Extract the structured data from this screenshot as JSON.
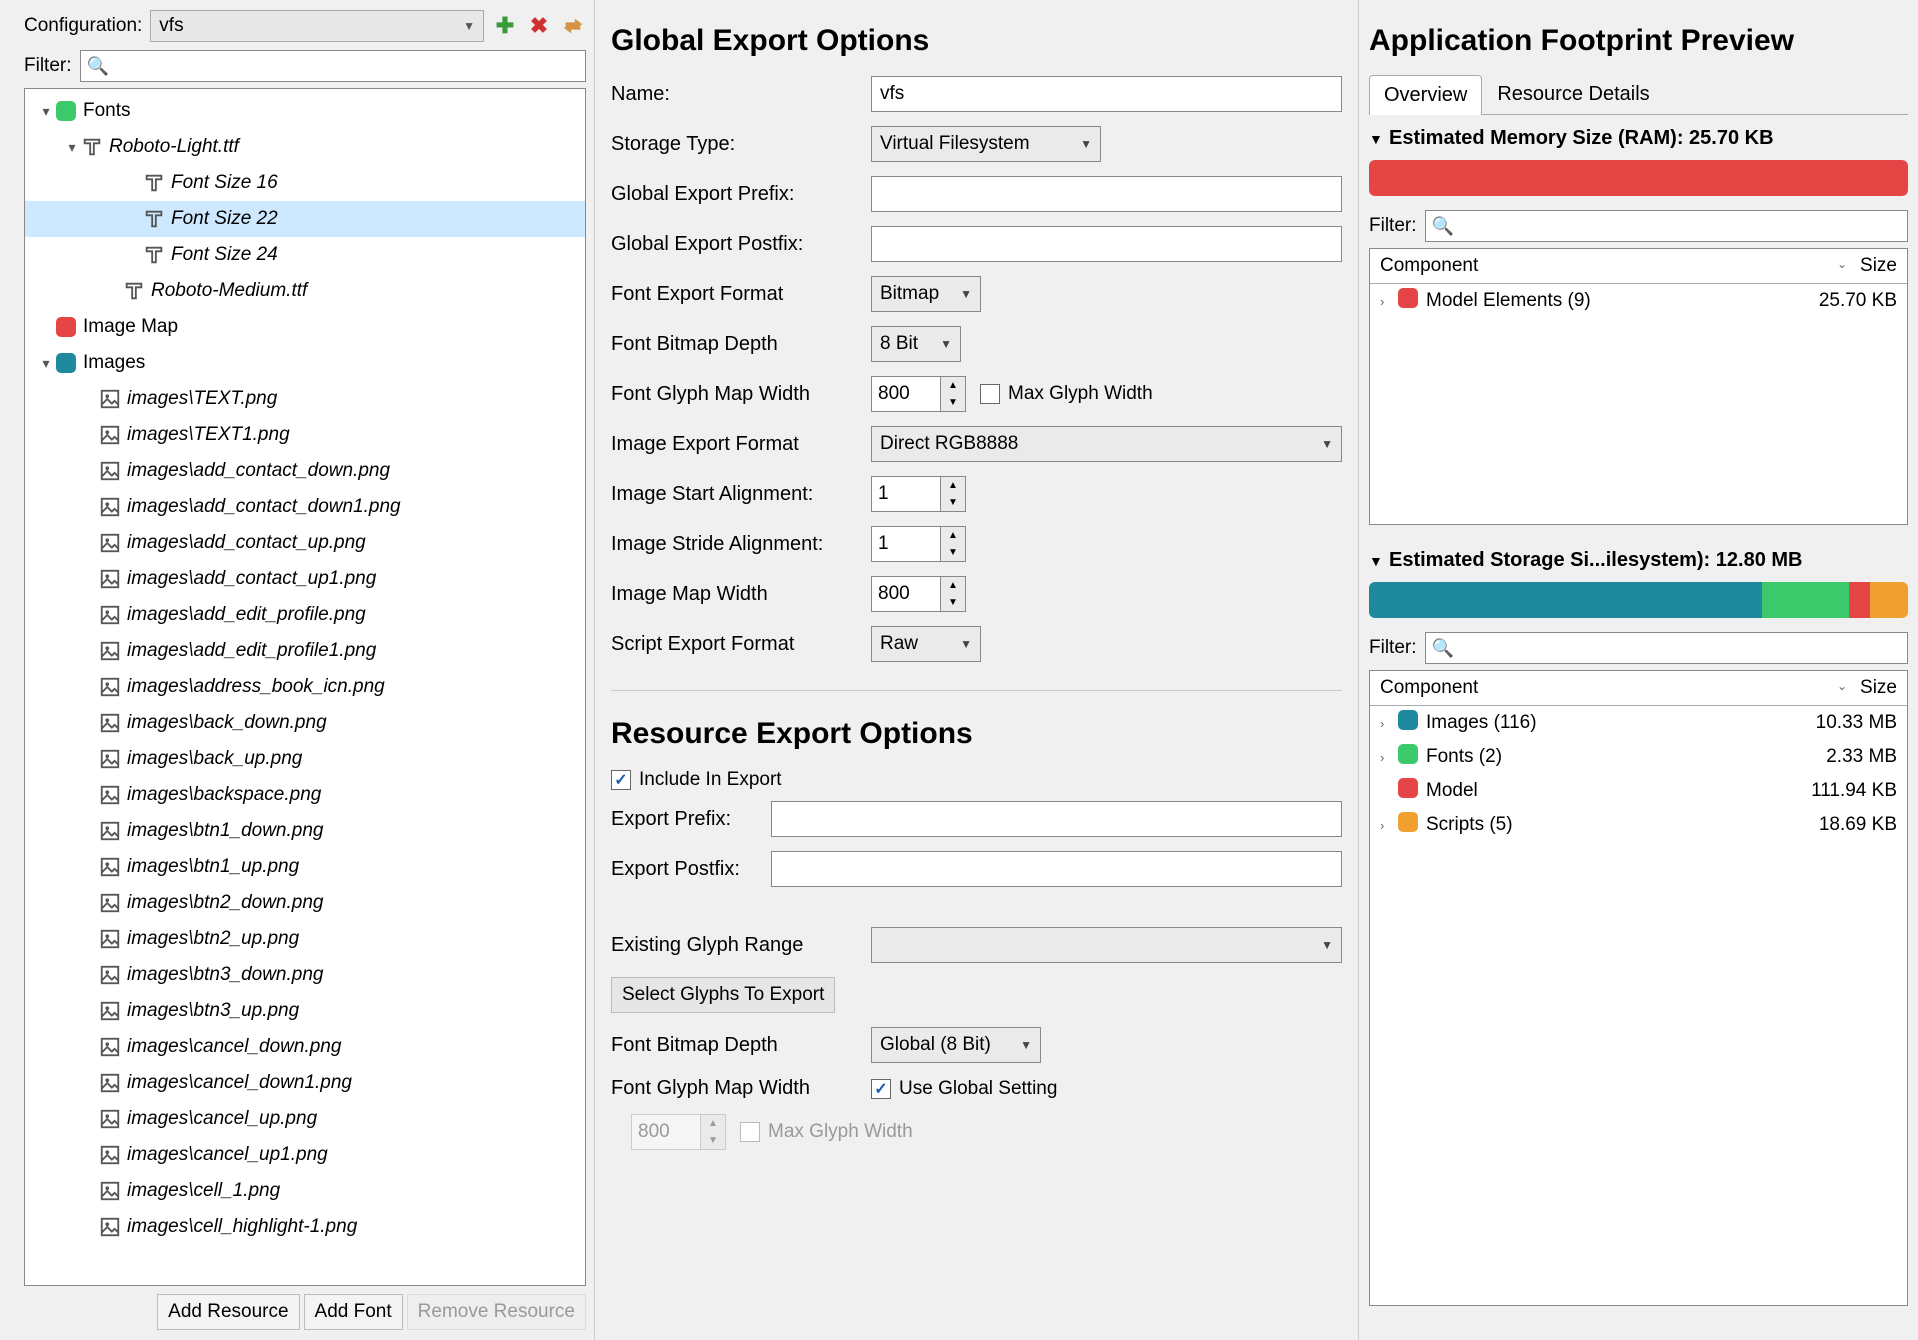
{
  "left": {
    "configuration_label": "Configuration:",
    "configuration_value": "vfs",
    "filter_label": "Filter:",
    "tree": {
      "fonts_label": "Fonts",
      "roboto_light": "Roboto-Light.ttf",
      "fs16": "Font Size 16",
      "fs22": "Font Size 22",
      "fs24": "Font Size 24",
      "roboto_medium": "Roboto-Medium.ttf",
      "image_map": "Image Map",
      "images_label": "Images",
      "images": [
        "images\\TEXT.png",
        "images\\TEXT1.png",
        "images\\add_contact_down.png",
        "images\\add_contact_down1.png",
        "images\\add_contact_up.png",
        "images\\add_contact_up1.png",
        "images\\add_edit_profile.png",
        "images\\add_edit_profile1.png",
        "images\\address_book_icn.png",
        "images\\back_down.png",
        "images\\back_up.png",
        "images\\backspace.png",
        "images\\btn1_down.png",
        "images\\btn1_up.png",
        "images\\btn2_down.png",
        "images\\btn2_up.png",
        "images\\btn3_down.png",
        "images\\btn3_up.png",
        "images\\cancel_down.png",
        "images\\cancel_down1.png",
        "images\\cancel_up.png",
        "images\\cancel_up1.png",
        "images\\cell_1.png",
        "images\\cell_highlight-1.png"
      ]
    },
    "buttons": {
      "add_resource": "Add Resource",
      "add_font": "Add Font",
      "remove_resource": "Remove Resource"
    }
  },
  "center": {
    "global_title": "Global Export Options",
    "name_label": "Name:",
    "name_value": "vfs",
    "storage_label": "Storage Type:",
    "storage_value": "Virtual Filesystem",
    "prefix_label": "Global Export Prefix:",
    "prefix_value": "",
    "postfix_label": "Global Export Postfix:",
    "postfix_value": "",
    "font_format_label": "Font Export Format",
    "font_format_value": "Bitmap",
    "font_depth_label": "Font Bitmap Depth",
    "font_depth_value": "8 Bit",
    "glyph_width_label": "Font Glyph Map Width",
    "glyph_width_value": "800",
    "max_glyph_label": "Max Glyph Width",
    "image_format_label": "Image Export Format",
    "image_format_value": "Direct RGB8888",
    "img_start_label": "Image Start Alignment:",
    "img_start_value": "1",
    "img_stride_label": "Image Stride Alignment:",
    "img_stride_value": "1",
    "img_map_label": "Image Map Width",
    "img_map_value": "800",
    "script_format_label": "Script Export Format",
    "script_format_value": "Raw",
    "resource_title": "Resource Export Options",
    "include_label": "Include In Export",
    "export_prefix_label": "Export Prefix:",
    "export_postfix_label": "Export Postfix:",
    "existing_range_label": "Existing Glyph Range",
    "select_glyphs_btn": "Select Glyphs To Export",
    "res_font_depth_label": "Font Bitmap Depth",
    "res_font_depth_value": "Global (8 Bit)",
    "res_glyph_width_label": "Font Glyph Map Width",
    "use_global_label": "Use Global Setting",
    "res_glyph_value": "800",
    "res_max_glyph_label": "Max Glyph Width"
  },
  "right": {
    "title": "Application Footprint Preview",
    "tab_overview": "Overview",
    "tab_details": "Resource Details",
    "ram_header": "Estimated Memory Size (RAM): 25.70 KB",
    "filter_label": "Filter:",
    "col_component": "Component",
    "col_size": "Size",
    "ram_rows": [
      {
        "name": "Model Elements (9)",
        "size": "25.70 KB",
        "color": "#e64545",
        "expandable": true
      }
    ],
    "storage_header": "Estimated Storage Si...ilesystem): 12.80 MB",
    "storage_segments": [
      {
        "color": "#1f8a9e",
        "pct": 73
      },
      {
        "color": "#3cc96b",
        "pct": 16
      },
      {
        "color": "#e64545",
        "pct": 4
      },
      {
        "color": "#f0a030",
        "pct": 7
      }
    ],
    "storage_rows": [
      {
        "name": "Images (116)",
        "size": "10.33 MB",
        "color": "#1f8a9e",
        "expandable": true
      },
      {
        "name": "Fonts (2)",
        "size": "2.33 MB",
        "color": "#3cc96b",
        "expandable": true
      },
      {
        "name": "Model",
        "size": "111.94 KB",
        "color": "#e64545",
        "expandable": false
      },
      {
        "name": "Scripts (5)",
        "size": "18.69 KB",
        "color": "#f0a030",
        "expandable": true
      }
    ]
  }
}
